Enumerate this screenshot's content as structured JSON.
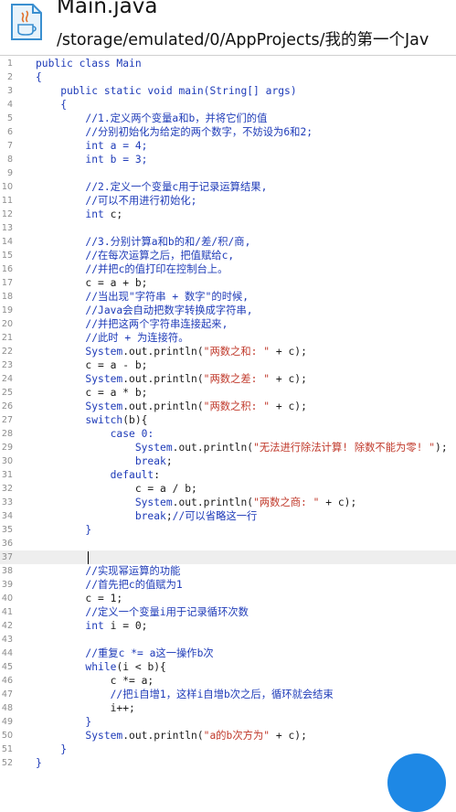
{
  "header": {
    "title": "Main.java",
    "path": "/storage/emulated/0/AppProjects/我的第一个Jav"
  },
  "editor": {
    "lines": [
      {
        "n": "1",
        "parts": [
          {
            "t": "public class Main",
            "c": "kw"
          }
        ]
      },
      {
        "n": "2",
        "parts": [
          {
            "t": "{",
            "c": "kw"
          }
        ]
      },
      {
        "n": "3",
        "parts": [
          {
            "t": "    public static void ",
            "c": "kw"
          },
          {
            "t": "main(String[] args)",
            "c": "kw"
          }
        ]
      },
      {
        "n": "4",
        "parts": [
          {
            "t": "    {",
            "c": "kw"
          }
        ]
      },
      {
        "n": "5",
        "parts": [
          {
            "t": "        //1.定义两个变量a和b，并将它们的值",
            "c": "cm"
          }
        ]
      },
      {
        "n": "6",
        "parts": [
          {
            "t": "        //分别初始化为给定的两个数字，不妨设为6和2;",
            "c": "cm"
          }
        ]
      },
      {
        "n": "7",
        "parts": [
          {
            "t": "        ",
            "c": ""
          },
          {
            "t": "int",
            "c": "kw"
          },
          {
            "t": " a = 4;",
            "c": "kw"
          }
        ]
      },
      {
        "n": "8",
        "parts": [
          {
            "t": "        ",
            "c": ""
          },
          {
            "t": "int",
            "c": "kw"
          },
          {
            "t": " b = 3;",
            "c": "kw"
          }
        ]
      },
      {
        "n": "9",
        "parts": []
      },
      {
        "n": "10",
        "parts": [
          {
            "t": "        //2.定义一个变量c用于记录运算结果,",
            "c": "cm"
          }
        ]
      },
      {
        "n": "11",
        "parts": [
          {
            "t": "        //可以不用进行初始化;",
            "c": "cm"
          }
        ]
      },
      {
        "n": "12",
        "parts": [
          {
            "t": "        ",
            "c": ""
          },
          {
            "t": "int",
            "c": "kw"
          },
          {
            "t": " c;",
            "c": ""
          }
        ]
      },
      {
        "n": "13",
        "parts": []
      },
      {
        "n": "14",
        "parts": [
          {
            "t": "        //3.分别计算a和b的和/差/积/商,",
            "c": "cm"
          }
        ]
      },
      {
        "n": "15",
        "parts": [
          {
            "t": "        //在每次运算之后，把值赋给c,",
            "c": "cm"
          }
        ]
      },
      {
        "n": "16",
        "parts": [
          {
            "t": "        //并把c的值打印在控制台上。",
            "c": "cm"
          }
        ]
      },
      {
        "n": "17",
        "parts": [
          {
            "t": "        c = a + b;",
            "c": ""
          }
        ]
      },
      {
        "n": "18",
        "parts": [
          {
            "t": "        //当出现\"字符串 + 数字\"的时候,",
            "c": "cm"
          }
        ]
      },
      {
        "n": "19",
        "parts": [
          {
            "t": "        //Java会自动把数字转换成字符串,",
            "c": "cm"
          }
        ]
      },
      {
        "n": "20",
        "parts": [
          {
            "t": "        //并把这两个字符串连接起来,",
            "c": "cm"
          }
        ]
      },
      {
        "n": "21",
        "parts": [
          {
            "t": "        //此时 + 为连接符。",
            "c": "cm"
          }
        ]
      },
      {
        "n": "22",
        "parts": [
          {
            "t": "        ",
            "c": ""
          },
          {
            "t": "System",
            "c": "cls"
          },
          {
            "t": ".out.println(",
            "c": ""
          },
          {
            "t": "\"两数之和: \"",
            "c": "str"
          },
          {
            "t": " + c);",
            "c": ""
          }
        ]
      },
      {
        "n": "23",
        "parts": [
          {
            "t": "        c = a - b;",
            "c": ""
          }
        ]
      },
      {
        "n": "24",
        "parts": [
          {
            "t": "        ",
            "c": ""
          },
          {
            "t": "System",
            "c": "cls"
          },
          {
            "t": ".out.println(",
            "c": ""
          },
          {
            "t": "\"两数之差: \"",
            "c": "str"
          },
          {
            "t": " + c);",
            "c": ""
          }
        ]
      },
      {
        "n": "25",
        "parts": [
          {
            "t": "        c = a * b;",
            "c": ""
          }
        ]
      },
      {
        "n": "26",
        "parts": [
          {
            "t": "        ",
            "c": ""
          },
          {
            "t": "System",
            "c": "cls"
          },
          {
            "t": ".out.println(",
            "c": ""
          },
          {
            "t": "\"两数之积: \"",
            "c": "str"
          },
          {
            "t": " + c);",
            "c": ""
          }
        ]
      },
      {
        "n": "27",
        "parts": [
          {
            "t": "        ",
            "c": ""
          },
          {
            "t": "switch",
            "c": "kw"
          },
          {
            "t": "(b){",
            "c": ""
          }
        ]
      },
      {
        "n": "28",
        "parts": [
          {
            "t": "            ",
            "c": ""
          },
          {
            "t": "case",
            "c": "kw"
          },
          {
            "t": " 0:",
            "c": "kw"
          }
        ]
      },
      {
        "n": "29",
        "parts": [
          {
            "t": "                ",
            "c": ""
          },
          {
            "t": "System",
            "c": "cls"
          },
          {
            "t": ".out.println(",
            "c": ""
          },
          {
            "t": "\"无法进行除法计算! 除数不能为零! \"",
            "c": "str"
          },
          {
            "t": ");",
            "c": ""
          }
        ]
      },
      {
        "n": "30",
        "parts": [
          {
            "t": "                ",
            "c": ""
          },
          {
            "t": "break",
            "c": "kw"
          },
          {
            "t": ";",
            "c": ""
          }
        ]
      },
      {
        "n": "31",
        "parts": [
          {
            "t": "            ",
            "c": ""
          },
          {
            "t": "default",
            "c": "kw"
          },
          {
            "t": ":",
            "c": ""
          }
        ]
      },
      {
        "n": "32",
        "parts": [
          {
            "t": "                c = a / b;",
            "c": ""
          }
        ]
      },
      {
        "n": "33",
        "parts": [
          {
            "t": "                ",
            "c": ""
          },
          {
            "t": "System",
            "c": "cls"
          },
          {
            "t": ".out.println(",
            "c": ""
          },
          {
            "t": "\"两数之商: \"",
            "c": "str"
          },
          {
            "t": " + c);",
            "c": ""
          }
        ]
      },
      {
        "n": "34",
        "parts": [
          {
            "t": "                ",
            "c": ""
          },
          {
            "t": "break",
            "c": "kw"
          },
          {
            "t": ";",
            "c": ""
          },
          {
            "t": "//可以省略这一行",
            "c": "cm"
          }
        ]
      },
      {
        "n": "35",
        "parts": [
          {
            "t": "        }",
            "c": "kw"
          }
        ]
      },
      {
        "n": "36",
        "parts": []
      },
      {
        "n": "37",
        "parts": [],
        "current": true
      },
      {
        "n": "38",
        "parts": [
          {
            "t": "        //实现幂运算的功能",
            "c": "cm"
          }
        ]
      },
      {
        "n": "39",
        "parts": [
          {
            "t": "        //首先把c的值赋为1",
            "c": "cm"
          }
        ]
      },
      {
        "n": "40",
        "parts": [
          {
            "t": "        c = 1;",
            "c": ""
          }
        ]
      },
      {
        "n": "41",
        "parts": [
          {
            "t": "        //定义一个变量i用于记录循环次数",
            "c": "cm"
          }
        ]
      },
      {
        "n": "42",
        "parts": [
          {
            "t": "        ",
            "c": ""
          },
          {
            "t": "int",
            "c": "kw"
          },
          {
            "t": " i = 0;",
            "c": ""
          }
        ]
      },
      {
        "n": "43",
        "parts": []
      },
      {
        "n": "44",
        "parts": [
          {
            "t": "        //重复c *= a这一操作b次",
            "c": "cm"
          }
        ]
      },
      {
        "n": "45",
        "parts": [
          {
            "t": "        ",
            "c": ""
          },
          {
            "t": "while",
            "c": "kw"
          },
          {
            "t": "(i < b){",
            "c": ""
          }
        ]
      },
      {
        "n": "46",
        "parts": [
          {
            "t": "            c *= a;",
            "c": ""
          }
        ]
      },
      {
        "n": "47",
        "parts": [
          {
            "t": "            //把i自增1，这样i自增b次之后，循环就会结束",
            "c": "cm"
          }
        ]
      },
      {
        "n": "48",
        "parts": [
          {
            "t": "            i++;",
            "c": ""
          }
        ]
      },
      {
        "n": "49",
        "parts": [
          {
            "t": "        }",
            "c": "kw"
          }
        ]
      },
      {
        "n": "50",
        "parts": [
          {
            "t": "        ",
            "c": ""
          },
          {
            "t": "System",
            "c": "cls"
          },
          {
            "t": ".out.println(",
            "c": ""
          },
          {
            "t": "\"a的b次方为\"",
            "c": "str"
          },
          {
            "t": " + c);",
            "c": ""
          }
        ]
      },
      {
        "n": "51",
        "parts": [
          {
            "t": "    }",
            "c": "kw"
          }
        ]
      },
      {
        "n": "52",
        "parts": [
          {
            "t": "}",
            "c": "kw"
          }
        ]
      }
    ]
  },
  "colors": {
    "keyword": "#1e3bb8",
    "string": "#c0392b",
    "fab": "#1e88e5"
  },
  "icons": {
    "file": "java-file-icon",
    "fab": "action-fab"
  }
}
